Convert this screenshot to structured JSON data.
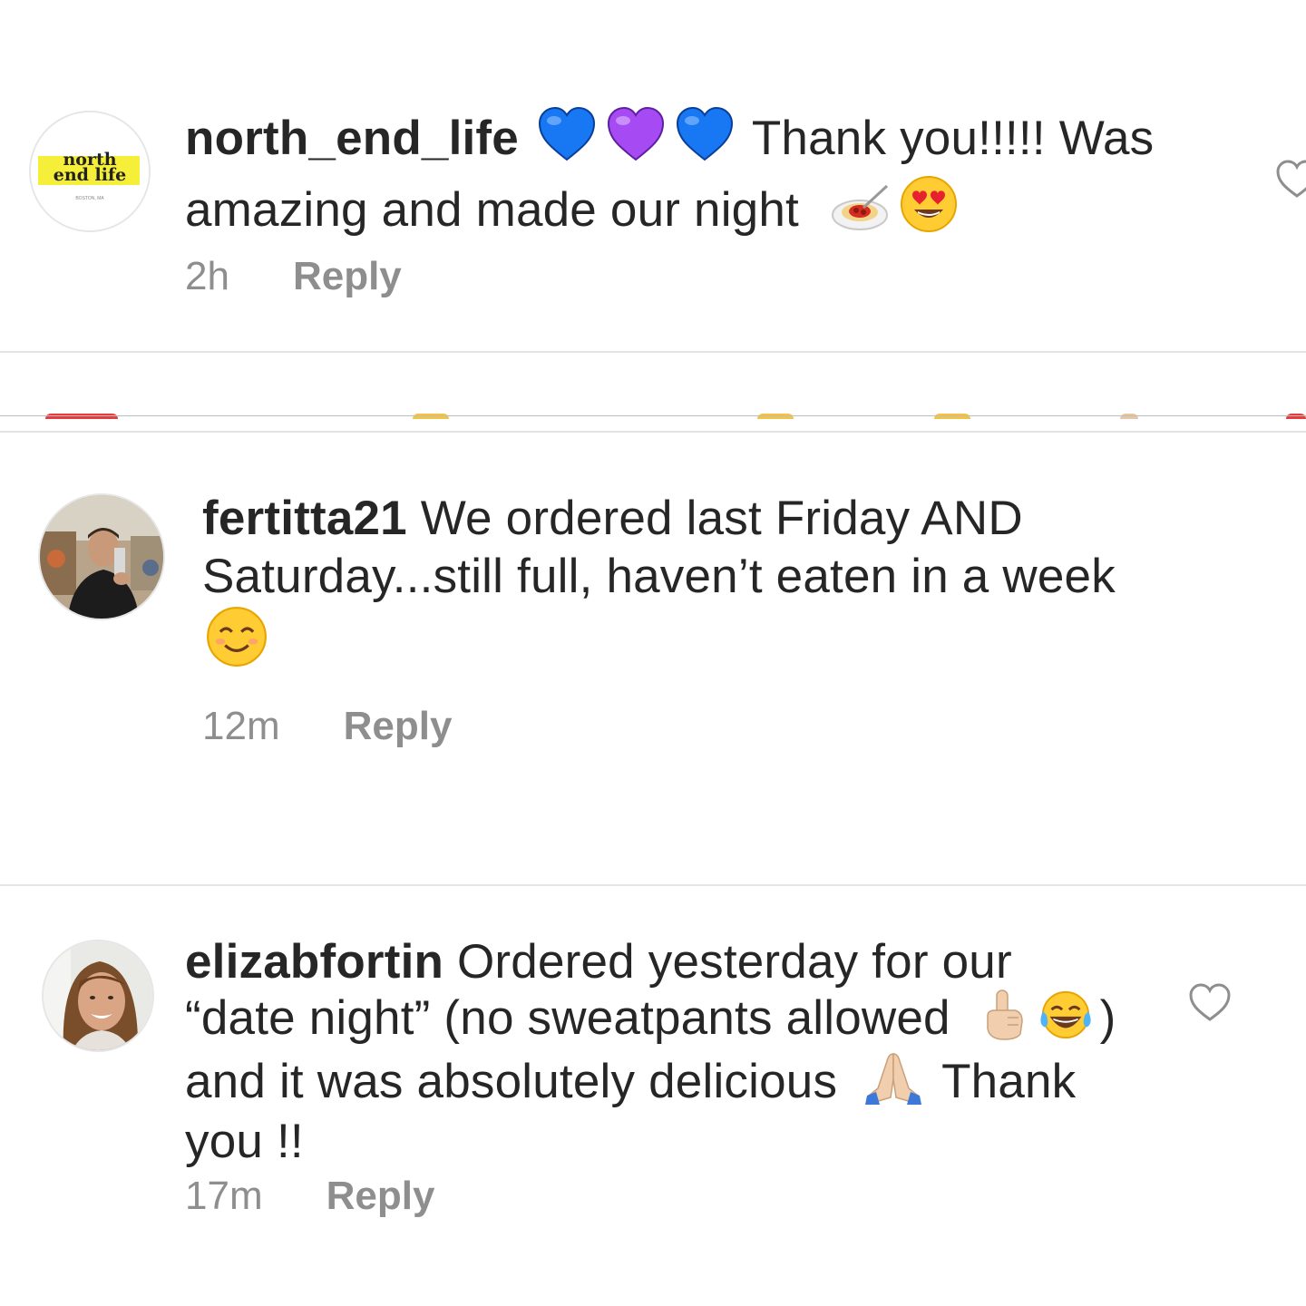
{
  "comments": [
    {
      "username": "north_end_life",
      "avatar_text": "north\nend life",
      "avatar_subtext": "BOSTON, MA",
      "line1_text": " Thank you!!!!! Was",
      "line2_text": "amazing and made our night",
      "emojis_line1": [
        "blue-heart",
        "purple-heart",
        "blue-heart"
      ],
      "emojis_line2": [
        "spaghetti",
        "heart-eyes"
      ],
      "time": "2h",
      "reply_label": "Reply"
    },
    {
      "username": "fertitta21",
      "line1_text": " We ordered last Friday AND",
      "line2_text": "Saturday...still full, haven’t eaten in a week",
      "emojis_line3": [
        "smiling-face"
      ],
      "time": "12m",
      "reply_label": "Reply"
    },
    {
      "username": "elizabfortin",
      "line1_text": " Ordered yesterday for our",
      "line2_text": "“date night” (no sweatpants allowed",
      "line2_tail": ")",
      "line3_text": "and it was absolutely delicious",
      "line3_tail": " Thank",
      "line4_text": "you !!",
      "emojis_line2": [
        "index-pointing-up",
        "tears-of-joy"
      ],
      "emojis_line3": [
        "folded-hands"
      ],
      "time": "17m",
      "reply_label": "Reply"
    }
  ],
  "colors": {
    "text": "#262626",
    "meta": "#8e8e8e",
    "divider": "#e4e4e4",
    "blue_heart": "#1877f2",
    "purple_heart": "#a64bf4"
  },
  "icons": [
    "heart-outline-icon"
  ]
}
